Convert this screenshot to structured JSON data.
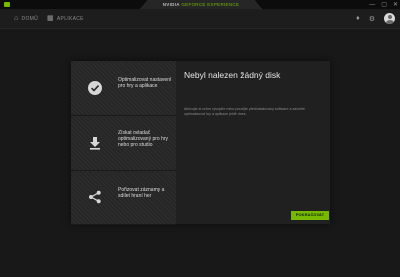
{
  "app": {
    "title_part1": "NVIDIA",
    "title_part2": "GEFORCE EXPERIENCE",
    "brand_color": "#76b900"
  },
  "titlebar": {
    "controls": [
      {
        "name": "minimize-icon",
        "glyph": "—"
      },
      {
        "name": "maximize-icon",
        "glyph": "▢"
      },
      {
        "name": "close-icon",
        "glyph": "✕"
      }
    ]
  },
  "nav": {
    "home": {
      "label": "DOMŮ",
      "icon": "home-icon"
    },
    "apps": {
      "label": "APLIKACE",
      "icon": "grid-icon"
    },
    "notifications_icon": "bell-icon",
    "settings_icon": "gear-icon",
    "avatar_icon": "user-avatar"
  },
  "steps": [
    {
      "icon": "checkmark-circle-icon",
      "label": "Optimalizovat nastavení pro hry a aplikace"
    },
    {
      "icon": "download-icon",
      "label": "Získat ovladač optimalizovaný pro hry nebo pro studio"
    },
    {
      "icon": "share-icon",
      "label": "Pořizovat záznamy a sdílet hraní her"
    }
  ],
  "main": {
    "heading": "Nebyl nalezen žádný disk",
    "description": "Aktivujte si režim vývojáře nebo použijte předinstalovaný software a začněte optimalizovat hry a aplikace ještě dnes.",
    "button_label": "POKRAČOVAT"
  }
}
